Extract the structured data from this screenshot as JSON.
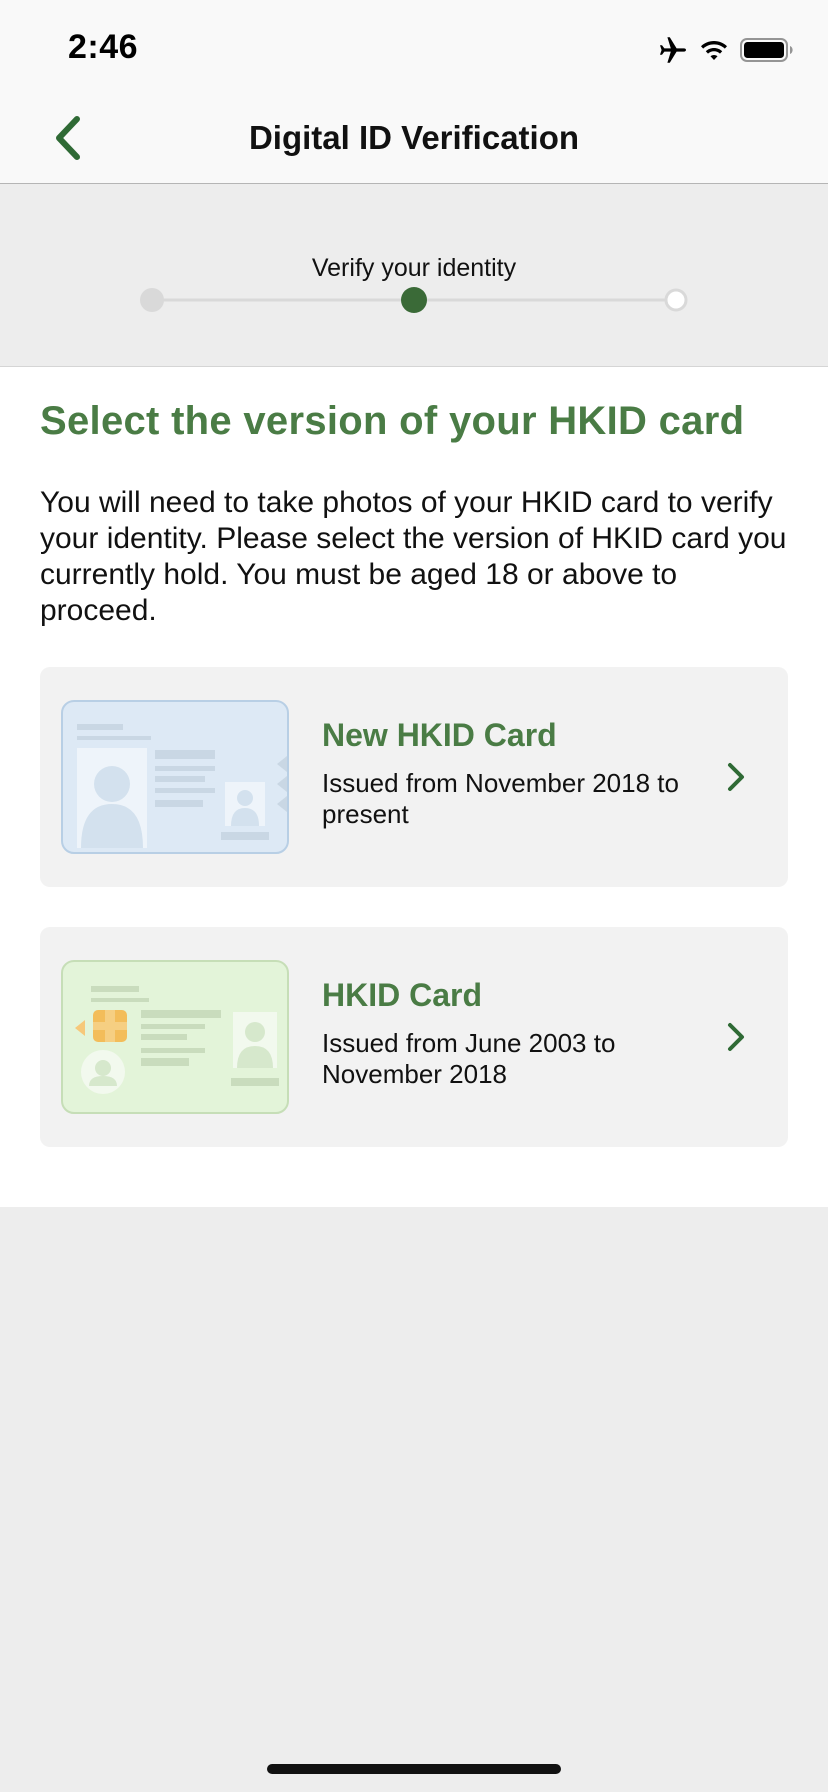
{
  "status_bar": {
    "time": "2:46",
    "icons": [
      "airplane-icon",
      "wifi-icon",
      "battery-icon"
    ]
  },
  "nav": {
    "back_icon": "chevron-left-icon",
    "title": "Digital ID Verification"
  },
  "progress": {
    "label": "Verify your identity",
    "total_steps": 3,
    "current_step": 2
  },
  "main": {
    "title": "Select the version of your HKID card",
    "description": "You will need to take photos of your HKID card to verify your identity. Please select the version of HKID card you currently hold. You must be aged 18 or above to proceed.",
    "options": [
      {
        "title": "New HKID Card",
        "subtitle": "Issued from November 2018 to present",
        "icon": "new-hkid-card-icon"
      },
      {
        "title": "HKID Card",
        "subtitle": "Issued from June 2003 to November 2018",
        "icon": "old-hkid-card-icon"
      }
    ]
  },
  "colors": {
    "accent": "#4a7c45",
    "dark_green": "#2f6a35",
    "background": "#ededed",
    "card_bg": "#f2f2f2"
  }
}
